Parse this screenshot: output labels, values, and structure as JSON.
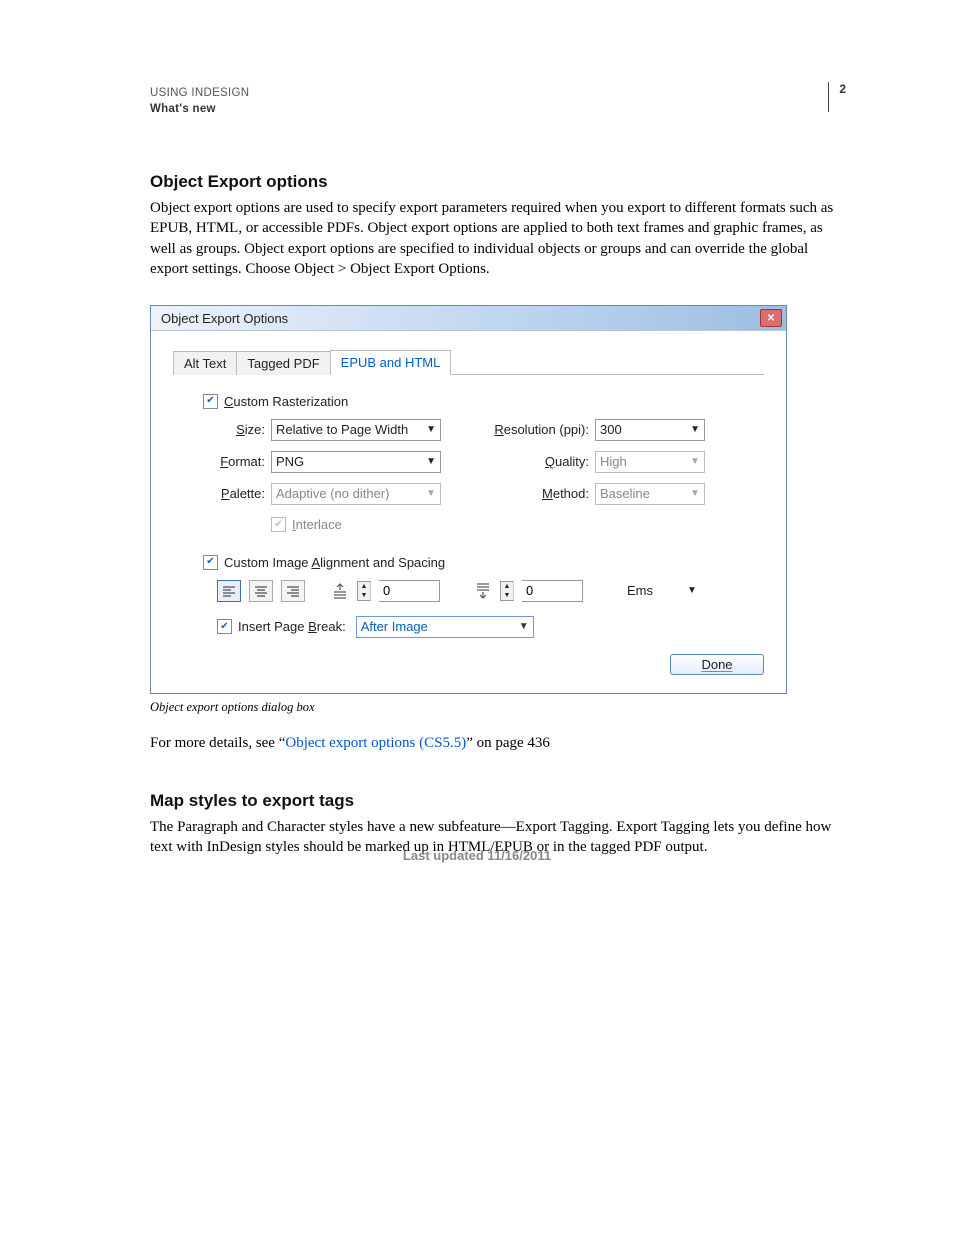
{
  "header": {
    "line1": "USING INDESIGN",
    "line2": "What's new",
    "page_number": "2"
  },
  "section1": {
    "heading": "Object Export options",
    "para": "Object export options are used to specify export parameters required when you export to different formats such as EPUB, HTML, or accessible PDFs. Object export options are applied to both text frames and graphic frames, as well as groups. Object export options are specified to individual objects or groups and can override the global export settings. Choose Object > Object Export Options."
  },
  "dialog": {
    "title": "Object Export Options",
    "tabs": {
      "t1": "Alt Text",
      "t2": "Tagged PDF",
      "t3": "EPUB and HTML"
    },
    "chk_raster_pre": "",
    "chk_raster_u": "C",
    "chk_raster_post": "ustom Rasterization",
    "labels": {
      "size_u": "S",
      "size_post": "ize:",
      "format_u": "F",
      "format_post": "ormat:",
      "palette_u": "P",
      "palette_post": "alette:",
      "res_u": "R",
      "res_post": "esolution (ppi):",
      "qual_u": "Q",
      "qual_post": "uality:",
      "meth_u": "M",
      "meth_post": "ethod:",
      "inter_u": "I",
      "inter_post": "nterlace",
      "align_pre": "Custom Image ",
      "align_u": "A",
      "align_post": "lignment and Spacing",
      "break_pre": "Insert Page ",
      "break_u": "B",
      "break_post": "reak:"
    },
    "values": {
      "size": "Relative to Page Width",
      "format": "PNG",
      "palette": "Adaptive (no dither)",
      "resolution": "300",
      "quality": "High",
      "method": "Baseline",
      "space_top": "0",
      "space_bottom": "0",
      "unit": "Ems",
      "page_break": "After Image"
    },
    "done": "Done"
  },
  "figcaption": "Object export options dialog box",
  "xref": {
    "pre": "For more details, see “",
    "link": "Object export options (CS5.5)",
    "post": "” on page 436"
  },
  "section2": {
    "heading": "Map styles to export tags",
    "para": "The Paragraph and Character styles have a new subfeature—Export Tagging. Export Tagging lets you define how text with InDesign styles should be marked up in HTML/EPUB or in the tagged PDF output."
  },
  "footer": "Last updated 11/16/2011"
}
